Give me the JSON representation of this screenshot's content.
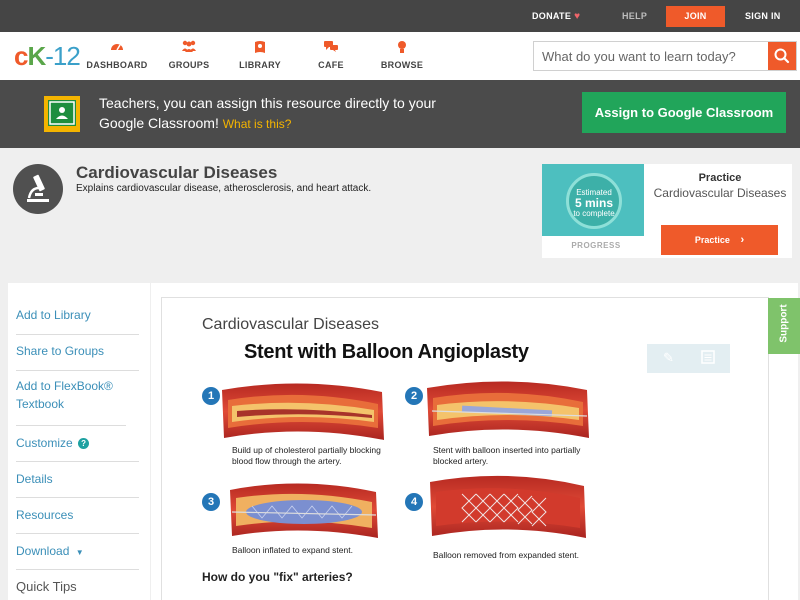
{
  "topbar": {
    "donate": "DONATE",
    "help": "HELP",
    "join": "JOIN",
    "signin": "SIGN IN"
  },
  "logo": {
    "c": "c",
    "k": "K",
    "n": "-12"
  },
  "nav": {
    "dashboard": "DASHBOARD",
    "groups": "GROUPS",
    "library": "LIBRARY",
    "cafe": "CAFE",
    "browse": "BROWSE"
  },
  "search": {
    "placeholder": "What do you want to learn today?"
  },
  "classroom_banner": {
    "text": "Teachers, you can assign this resource directly to your Google Classroom!",
    "what_link": "What is this?",
    "assign_button": "Assign to Google Classroom"
  },
  "header": {
    "title": "Cardiovascular Diseases",
    "description": "Explains cardiovascular disease, atherosclerosis, and heart attack."
  },
  "practice_card": {
    "estimated": "Estimated",
    "mins": "5 mins",
    "to_complete": "to complete",
    "progress": "PROGRESS",
    "label": "Practice",
    "subtitle": "Cardiovascular Diseases",
    "button": "Practice"
  },
  "sidebar": {
    "items": [
      {
        "label": "Add to Library"
      },
      {
        "label": "Share to Groups"
      },
      {
        "label": "Add to FlexBook® Textbook"
      },
      {
        "label": "Customize"
      },
      {
        "label": "Details"
      },
      {
        "label": "Resources"
      },
      {
        "label": "Download"
      },
      {
        "label": "Quick Tips"
      }
    ],
    "help_glyph": "?"
  },
  "content": {
    "section_heading": "Cardiovascular Diseases",
    "figure_title": "Stent with Balloon Angioplasty",
    "steps": [
      {
        "number": "1",
        "caption": "Build up of cholesterol partially blocking blood flow through the artery."
      },
      {
        "number": "2",
        "caption": "Stent with balloon inserted into partially blocked artery."
      },
      {
        "number": "3",
        "caption": "Balloon inflated to expand stent."
      },
      {
        "number": "4",
        "caption": "Balloon removed from expanded stent."
      }
    ],
    "question": "How do you \"fix\" arteries?"
  },
  "support_tab": "Support",
  "icons": {
    "heart": "heart-icon",
    "dashboard": "dashboard-icon",
    "groups": "groups-icon",
    "library": "library-icon",
    "cafe": "cafe-icon",
    "browse": "browse-icon",
    "search": "search-icon",
    "classroom": "google-classroom-icon",
    "microscope": "microscope-icon",
    "pencil": "pencil-icon",
    "note": "note-icon",
    "chevron": "chevron-right-icon",
    "caret": "caret-down-icon"
  },
  "colors": {
    "brand_orange": "#ef5a2a",
    "brand_green": "#5aa64a",
    "brand_blue": "#3ba0c9",
    "link_blue": "#3b8fb8",
    "assign_green": "#21a55a",
    "step_blue": "#2476b7",
    "support_green": "#7fc36b"
  }
}
